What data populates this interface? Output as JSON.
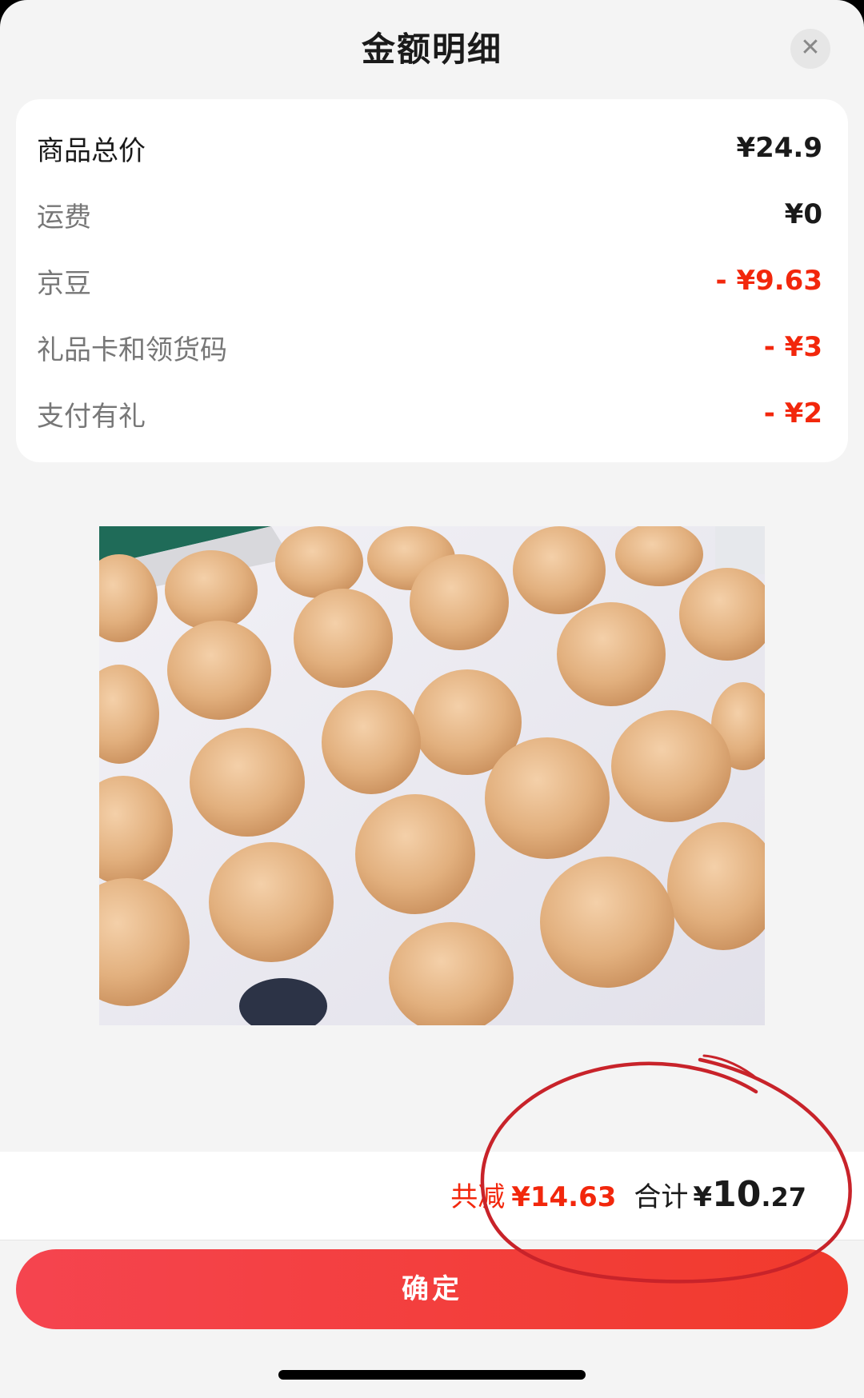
{
  "dialog": {
    "title": "金额明细",
    "close_icon": "close-icon"
  },
  "breakdown": [
    {
      "label": "商品总价",
      "amount": "¥24.9",
      "type": "normal"
    },
    {
      "label": "运费",
      "amount": "¥0",
      "type": "normal"
    },
    {
      "label": "京豆",
      "amount": "- ¥9.63",
      "type": "discount"
    },
    {
      "label": "礼品卡和领货码",
      "amount": "- ¥3",
      "type": "discount"
    },
    {
      "label": "支付有礼",
      "amount": "- ¥2",
      "type": "discount"
    }
  ],
  "summary": {
    "saved_label": "共减",
    "saved_amount": "¥14.63",
    "total_label": "合计",
    "total_symbol": "¥",
    "total_integer": "10",
    "total_decimal": ".27"
  },
  "confirm_button": {
    "label": "确定"
  },
  "colors": {
    "accent": "#f2270c",
    "button_start": "#f5444f",
    "button_end": "#f13a2c",
    "annotation": "#c8232a"
  }
}
